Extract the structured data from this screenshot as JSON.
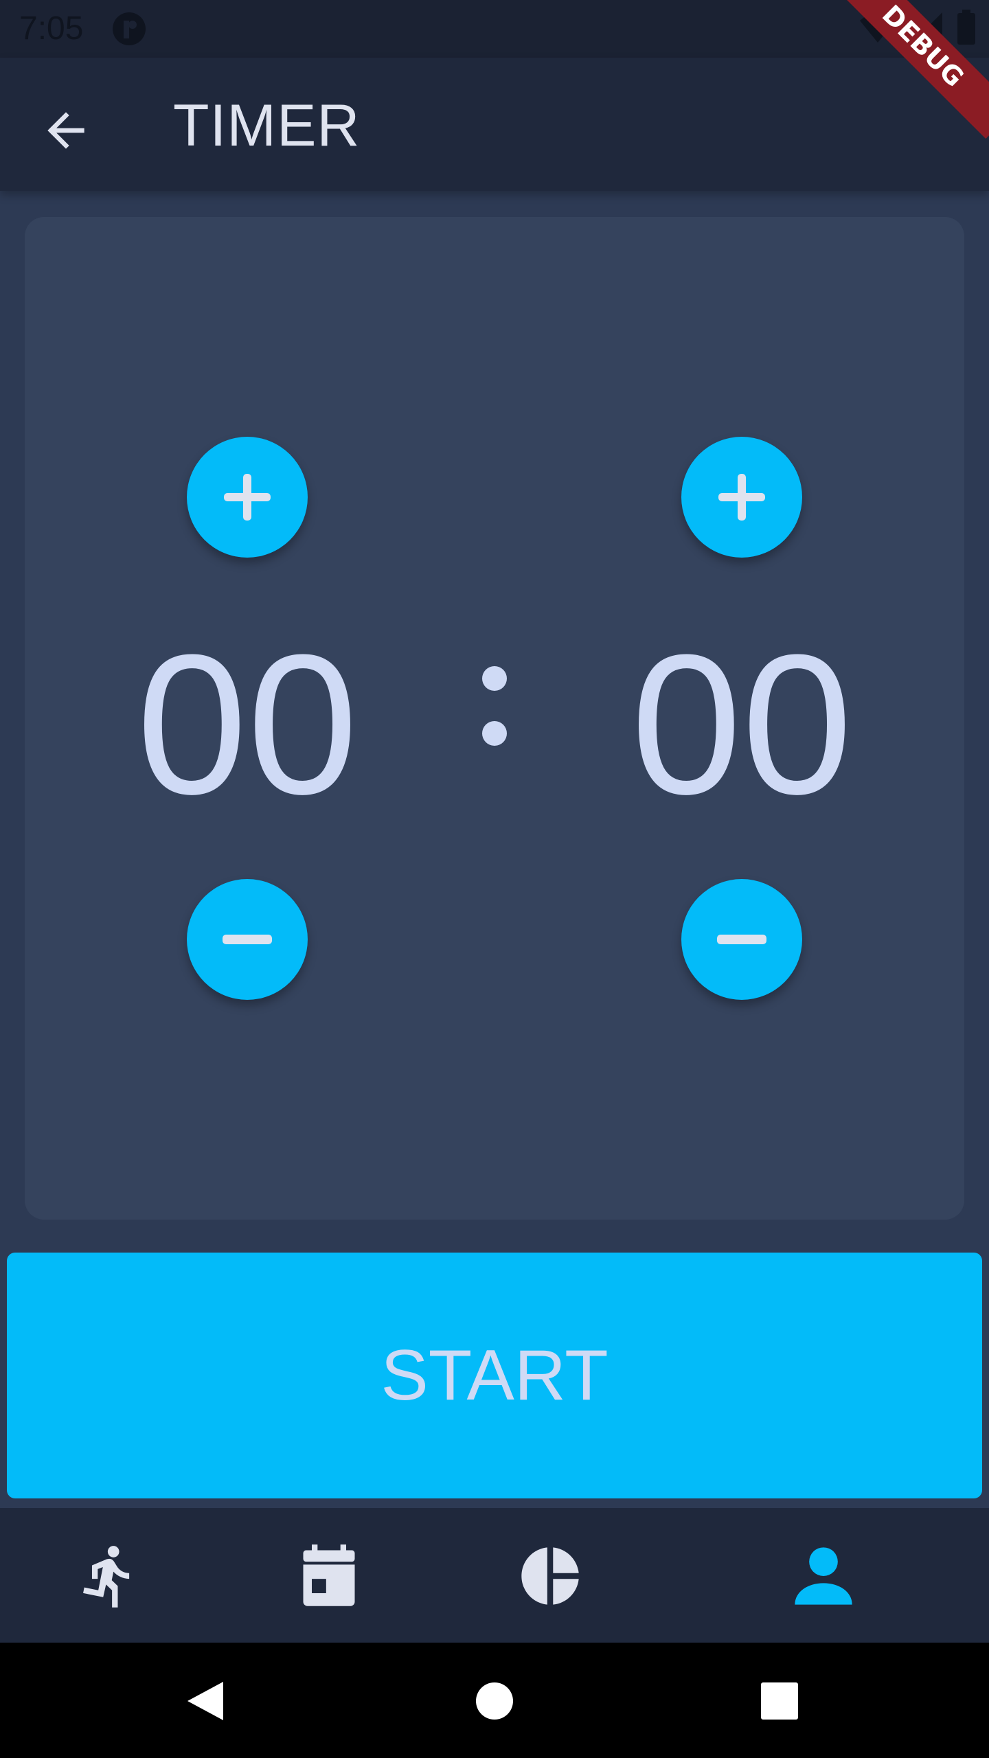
{
  "status_bar": {
    "time": "7:05",
    "icons": [
      "app-notification-icon",
      "wifi-icon",
      "signal-icon",
      "battery-icon"
    ]
  },
  "app_bar": {
    "title": "TIMER",
    "back_icon": "arrow-back-icon"
  },
  "debug_banner": "DEBUG",
  "timer": {
    "minutes": "00",
    "seconds": "00",
    "separator": ":"
  },
  "start_button": {
    "label": "START"
  },
  "bottom_nav": {
    "items": [
      {
        "name": "run",
        "icon": "running-icon",
        "active": false
      },
      {
        "name": "calendar",
        "icon": "calendar-icon",
        "active": false
      },
      {
        "name": "stats",
        "icon": "pie-chart-icon",
        "active": false
      },
      {
        "name": "profile",
        "icon": "person-icon",
        "active": true
      }
    ]
  },
  "colors": {
    "accent": "#03bbf9",
    "background": "#2d3a54",
    "card": "#35435d",
    "bar": "#1f283c",
    "text": "#cfdaf5"
  },
  "system_nav": [
    "back-triangle-icon",
    "home-circle-icon",
    "recents-square-icon"
  ]
}
